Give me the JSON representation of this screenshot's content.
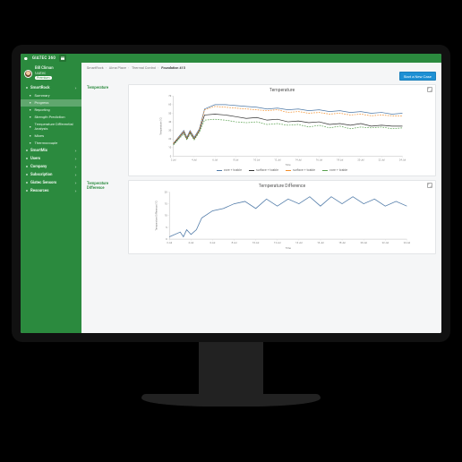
{
  "brand": {
    "name": "GIATEC 360"
  },
  "user": {
    "name": "Bill Climan",
    "company": "Giatec",
    "role": "Premium"
  },
  "sidebar": {
    "groups": [
      {
        "label": "SmartRock",
        "icon": "project-icon",
        "items": [
          {
            "label": "Summary",
            "icon": "overview-icon"
          },
          {
            "label": "Progress",
            "icon": "progress-icon",
            "active": true
          },
          {
            "label": "Reporting",
            "icon": "reporting-icon"
          },
          {
            "label": "Strength Prediction",
            "icon": "strength-icon"
          },
          {
            "label": "Temperature Differential Analysis",
            "icon": "temperature-icon"
          },
          {
            "label": "Mixes",
            "icon": "mixes-icon"
          },
          {
            "label": "Thermocouple",
            "icon": "thermocouple-icon"
          }
        ]
      },
      {
        "label": "SmartMix",
        "icon": "mix-icon",
        "items": []
      },
      {
        "label": "Users",
        "icon": "users-icon",
        "items": []
      },
      {
        "label": "Company",
        "icon": "company-icon",
        "items": []
      },
      {
        "label": "Subscription",
        "icon": "billing-icon",
        "items": []
      },
      {
        "label": "Giatec Sensors",
        "icon": "sensors-icon",
        "items": []
      },
      {
        "label": "Resources",
        "icon": "resources-icon",
        "items": []
      }
    ]
  },
  "breadcrumbs": {
    "items": [
      "SmartRock",
      "Alma Place",
      "Thermal Control"
    ],
    "current": "Foundation 415"
  },
  "actions": {
    "cta": "Start a New Case"
  },
  "panels": {
    "temperature": {
      "label": "Temperature",
      "title": "Temperature"
    },
    "difference": {
      "label": "Temperature Difference",
      "title": "Temperature Difference"
    }
  },
  "chart_data": [
    {
      "type": "line",
      "title": "Temperature",
      "xlabel": "Time",
      "ylabel": "Temperature (°C)",
      "ylim": [
        0,
        70
      ],
      "categories": [
        "2 Jul",
        "4 Jul",
        "6 Jul",
        "8 Jul",
        "10 Jul",
        "12 Jul",
        "14 Jul",
        "16 Jul",
        "18 Jul",
        "20 Jul",
        "22 Jul",
        "24 Jul"
      ],
      "x": [
        2,
        3,
        3.3,
        3.6,
        4,
        4.5,
        5,
        6,
        7,
        8,
        9,
        10,
        11,
        12,
        13,
        14,
        15,
        16,
        17,
        18,
        19,
        20,
        21,
        22,
        23,
        24
      ],
      "series": [
        {
          "name": "core + tcable",
          "color": "#4e79a7",
          "dashed": false,
          "values": [
            15,
            30,
            22,
            30,
            22,
            32,
            55,
            60,
            60,
            59,
            58,
            57,
            55,
            56,
            54,
            55,
            53,
            54,
            52,
            53,
            51,
            52,
            50,
            51,
            49,
            50
          ]
        },
        {
          "name": "surface + tcable",
          "color": "#333333",
          "dashed": false,
          "values": [
            14,
            28,
            20,
            28,
            20,
            30,
            48,
            49,
            48,
            46,
            44,
            45,
            42,
            43,
            40,
            41,
            39,
            40,
            37,
            38,
            36,
            38,
            35,
            36,
            35,
            35
          ]
        },
        {
          "name": "surface + tcable",
          "color": "#f28e2b",
          "dashed": true,
          "values": [
            15,
            29,
            21,
            29,
            21,
            31,
            54,
            58,
            57,
            56,
            55,
            54,
            53,
            54,
            51,
            52,
            50,
            51,
            49,
            50,
            48,
            49,
            47,
            48,
            47,
            47
          ]
        },
        {
          "name": "core + tcable",
          "color": "#59a14f",
          "dashed": true,
          "values": [
            13,
            26,
            19,
            26,
            19,
            28,
            42,
            43,
            42,
            40,
            39,
            40,
            37,
            38,
            36,
            37,
            34,
            36,
            33,
            35,
            32,
            34,
            33,
            34,
            32,
            33
          ]
        }
      ]
    },
    {
      "type": "line",
      "title": "Temperature Difference",
      "xlabel": "Time",
      "ylabel": "Temperature Difference (°C)",
      "ylim": [
        0,
        20
      ],
      "categories": [
        "2 Jul",
        "4 Jul",
        "6 Jul",
        "8 Jul",
        "10 Jul",
        "12 Jul",
        "14 Jul",
        "16 Jul",
        "18 Jul",
        "20 Jul",
        "22 Jul",
        "24 Jul"
      ],
      "x": [
        2,
        3,
        3.3,
        3.6,
        4,
        4.5,
        5,
        6,
        7,
        8,
        9,
        10,
        11,
        12,
        13,
        14,
        15,
        16,
        17,
        18,
        19,
        20,
        21,
        22,
        23,
        24
      ],
      "series": [
        {
          "name": "difference",
          "color": "#4e79a7",
          "dashed": false,
          "values": [
            1,
            3,
            1,
            4,
            2,
            4,
            9,
            12,
            13,
            15,
            16,
            13,
            17,
            14,
            17,
            15,
            18,
            14,
            18,
            15,
            18,
            15,
            17,
            14,
            16,
            14
          ]
        }
      ]
    }
  ]
}
